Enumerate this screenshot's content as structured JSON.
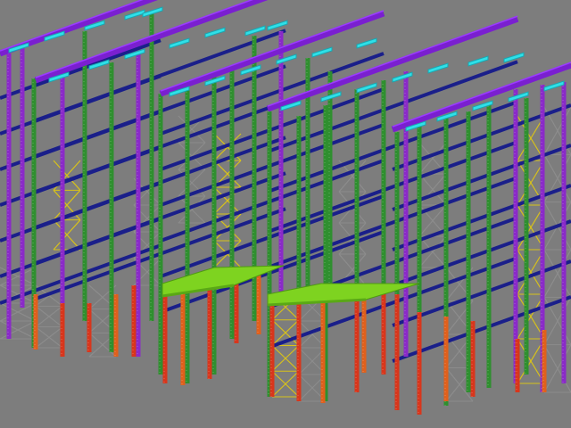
{
  "scene": {
    "kind": "3d-steel-structure-wireframe",
    "background": "#7d7d7d",
    "member_colors": {
      "top_beams": "#7a1fd0",
      "top_beam_highlight": "#9b3cff",
      "cap_plates": "#2fe0e8",
      "column_green": "#2f8f2f",
      "column_purple": "#8a2ac8",
      "column_red": "#d8361c",
      "column_orange": "#e0601c",
      "horizontal_beams": "#1a1f8a",
      "bracing_grey": "#8c8c8c",
      "bracing_yellow": "#d8c21a",
      "platform_deck": "#7ed320"
    }
  }
}
